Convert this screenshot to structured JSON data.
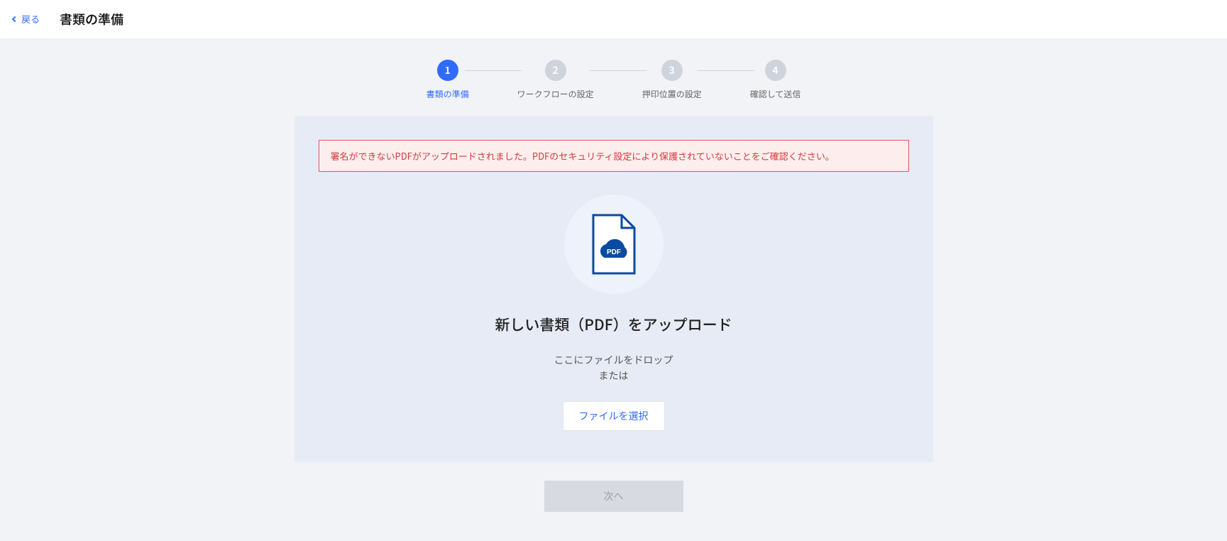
{
  "header": {
    "back_label": "戻る",
    "page_title": "書類の準備"
  },
  "stepper": {
    "steps": [
      {
        "num": "1",
        "label": "書類の準備",
        "active": true
      },
      {
        "num": "2",
        "label": "ワークフローの設定",
        "active": false
      },
      {
        "num": "3",
        "label": "押印位置の設定",
        "active": false
      },
      {
        "num": "4",
        "label": "確認して送信",
        "active": false
      }
    ]
  },
  "alert": {
    "message": "署名ができないPDFがアップロードされました。PDFのセキュリティ設定により保護されていないことをご確認ください。"
  },
  "upload": {
    "icon_badge": "PDF",
    "heading": "新しい書類（PDF）をアップロード",
    "drop_text": "ここにファイルをドロップ",
    "or_text": "または",
    "select_button": "ファイルを選択"
  },
  "footer": {
    "next_label": "次へ"
  },
  "colors": {
    "accent": "#2f6bff",
    "error": "#d23a3a",
    "card_bg": "#e7ebf5"
  }
}
